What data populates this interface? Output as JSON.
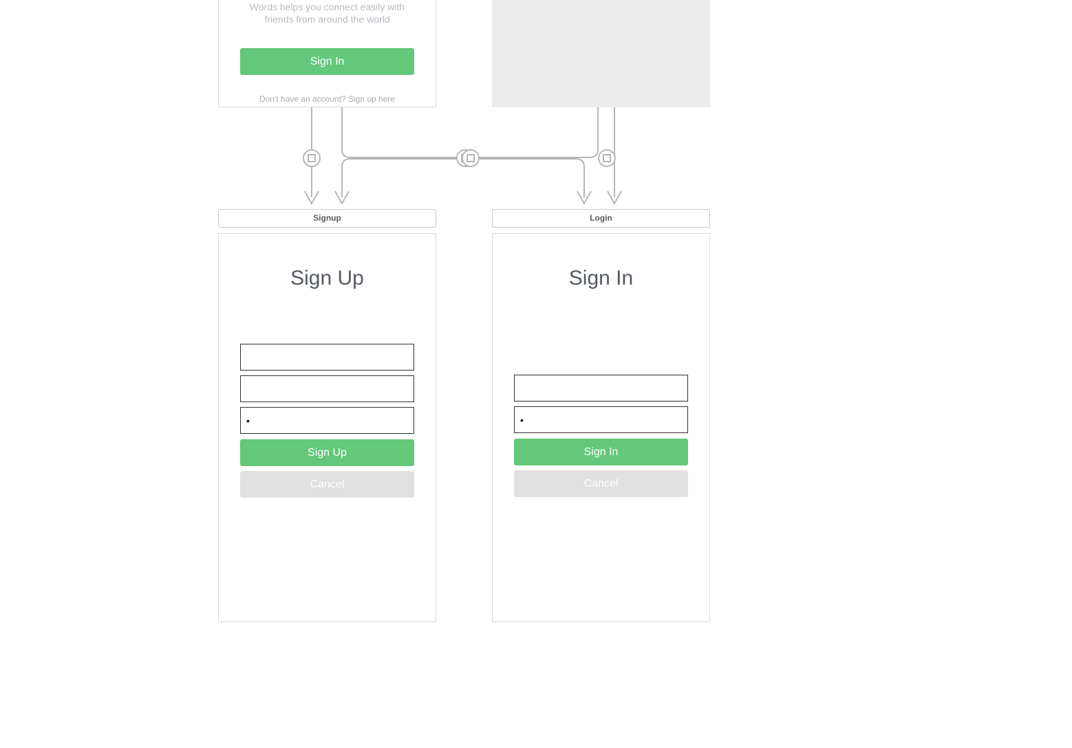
{
  "colors": {
    "accent": "#63c87a",
    "muted": "#e1e1e1",
    "line": "#b6b6b6"
  },
  "intro": {
    "tagline": "Words helps you connect easily with friends from around the world",
    "signin_label": "Sign In",
    "signup_link": "Don't have an account? Sign up here"
  },
  "labels": {
    "signup": "Signup",
    "login": "Login"
  },
  "signup": {
    "title": "Sign Up",
    "field1_value": "",
    "field2_value": "",
    "field3_value": "•",
    "submit_label": "Sign Up",
    "cancel_label": "Cancel"
  },
  "login": {
    "title": "Sign In",
    "field1_value": "",
    "field2_value": "•",
    "submit_label": "Sign In",
    "cancel_label": "Cancel"
  }
}
